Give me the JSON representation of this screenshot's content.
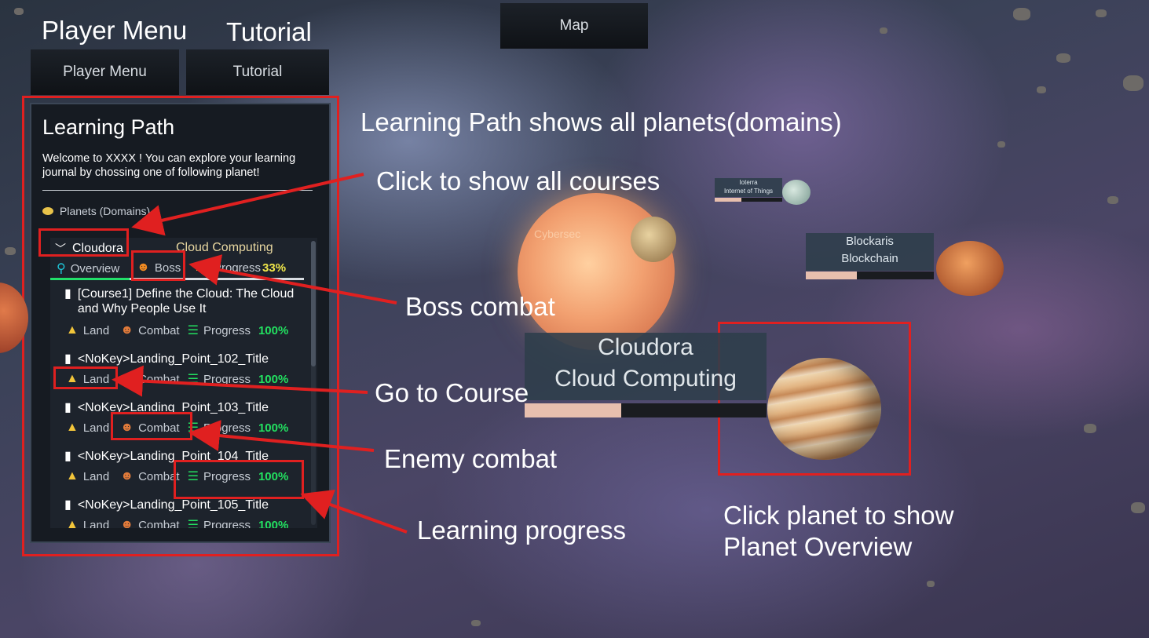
{
  "top": {
    "player_menu_title": "Player Menu",
    "tutorial_title": "Tutorial",
    "map_button": "Map",
    "player_menu_button": "Player Menu",
    "tutorial_button": "Tutorial"
  },
  "learning_path": {
    "title": "Learning Path",
    "welcome": "Welcome to XXXX ! You can explore your learning journal by chossing one of following planet!",
    "planets_heading": "Planets (Domains)",
    "planet": {
      "name": "Cloudora",
      "domain": "Cloud Computing",
      "tabs": {
        "overview": "Overview",
        "boss": "Boss",
        "progress_label": "Progress",
        "progress_value": "33%"
      }
    },
    "courses": [
      {
        "title": "[Course1] Define the Cloud: The Cloud and Why People Use It",
        "land": "Land",
        "combat": "Combat",
        "progress": "Progress",
        "pct": "100%"
      },
      {
        "title": "<NoKey>Landing_Point_102_Title",
        "land": "Land",
        "combat": "Combat",
        "progress": "Progress",
        "pct": "100%"
      },
      {
        "title": "<NoKey>Landing_Point_103_Title",
        "land": "Land",
        "combat": "Combat",
        "progress": "Progress",
        "pct": "100%"
      },
      {
        "title": "<NoKey>Landing_Point_104_Title",
        "land": "Land",
        "combat": "Combat",
        "progress": "Progress",
        "pct": "100%"
      },
      {
        "title": "<NoKey>Landing_Point_105_Title",
        "land": "Land",
        "combat": "Combat",
        "progress": "Progress",
        "pct": "100%"
      }
    ]
  },
  "annotations": {
    "learning_path": "Learning Path shows all planets(domains)",
    "show_courses": "Click to show all courses",
    "boss": "Boss combat",
    "go_course": "Go to Course",
    "enemy": "Enemy combat",
    "progress": "Learning progress",
    "planet_overview_1": "Click planet to show",
    "planet_overview_2": "Planet Overview"
  },
  "planets": {
    "cloudora": {
      "name": "Cloudora",
      "domain": "Cloud Computing",
      "progress": 0.33
    },
    "blockaris": {
      "name": "Blockaris",
      "domain": "Blockchain",
      "progress": 0.4
    },
    "iot": {
      "name": "Ioterra",
      "domain": "Internet of Things",
      "progress": 0.4
    },
    "cyber_label": "Cybersec"
  },
  "colors": {
    "annotation_red": "#e02020",
    "progress_green": "#22e060",
    "progress_yellow": "#f2e84a"
  }
}
